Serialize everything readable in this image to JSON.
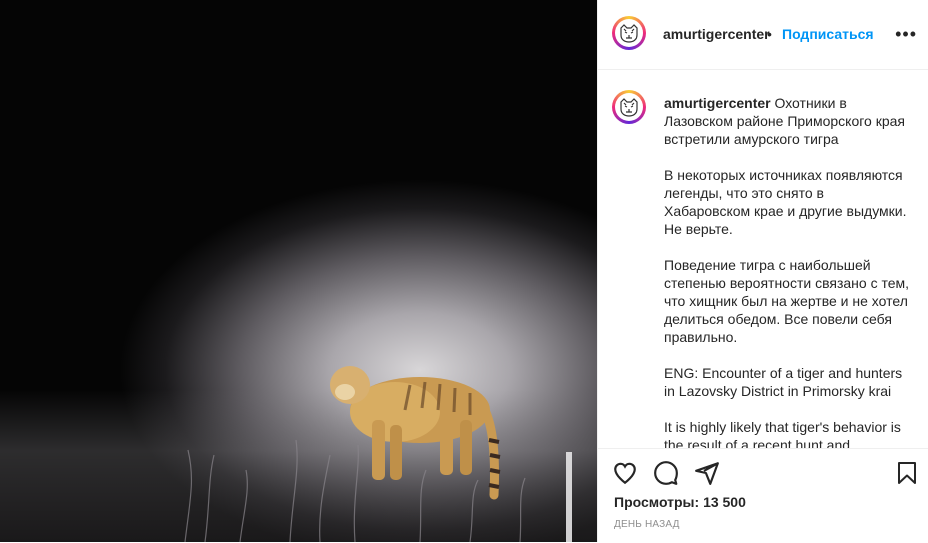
{
  "post": {
    "media_alt": "Video: Amur tiger at night in headlight",
    "username": "amurtigercenter",
    "separator": "•",
    "follow_label": "Подписаться",
    "more_label": "•••",
    "caption_user": "amurtigercenter",
    "caption_first": "Охотники в Лазовском районе Приморского края встретили амурского тигра",
    "caption_paragraphs": [
      "В некоторых источниках появляются легенды, что это снято в Хабаровском крае и другие выдумки. Не верьте.",
      "Поведение тигра с наибольшей степенью вероятности связано с тем, что хищник был на жертве и не хотел делиться обедом. Все повели себя правильно.",
      "ENG: Encounter of a tiger and hunters in Lazovsky District in Primorsky krai",
      "It is highly likely that tiger's behavior is the result of a recent hunt and"
    ],
    "views_label": "Просмотры:",
    "views_count": "13 500",
    "timestamp": "День назад"
  },
  "icons": {
    "like": "heart-icon",
    "comment": "comment-icon",
    "share": "share-icon",
    "save": "bookmark-icon",
    "more": "more-icon"
  },
  "colors": {
    "accent": "#0095f6",
    "text": "#262626",
    "muted": "#8e8e8e",
    "border": "#efefef"
  }
}
